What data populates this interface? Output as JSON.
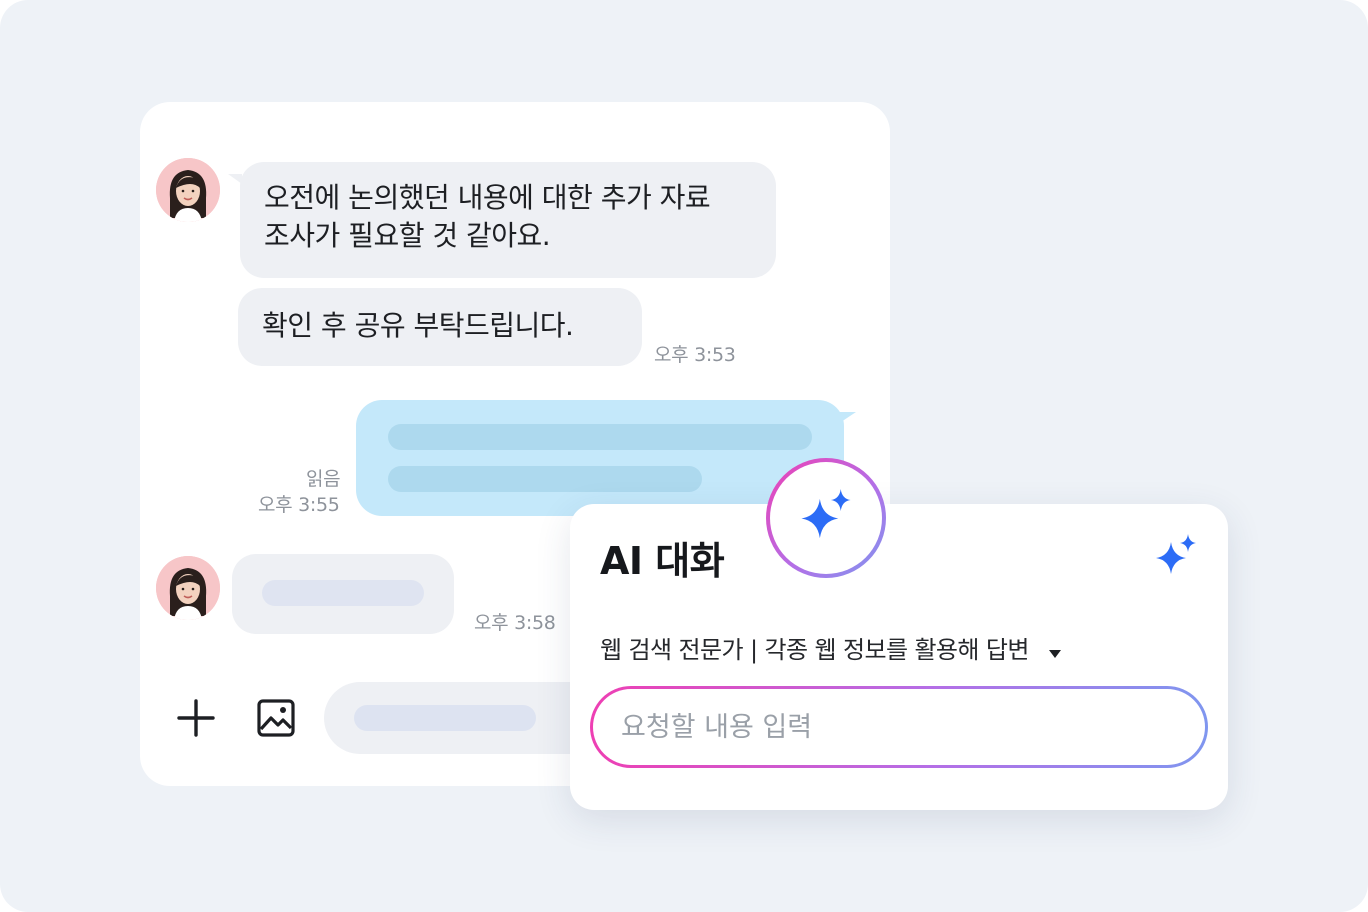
{
  "chat": {
    "messages": [
      {
        "line1": "오전에 논의했던 내용에 대한 추가 자료",
        "line2": "조사가 필요할 것 같아요."
      },
      {
        "text": "확인 후 공유 부탁드립니다.",
        "time": "오후 3:53"
      }
    ],
    "sent": {
      "status": "읽음",
      "time": "오후 3:55"
    },
    "reply": {
      "time": "오후 3:58"
    }
  },
  "icons": {
    "add": "plus-icon",
    "image": "image-icon",
    "sparkle": "sparkle-icon",
    "dropdown": "caret-down-icon"
  },
  "ai": {
    "title": "AI 대화",
    "mode": "웹 검색 전문가 | 각종 웹 정보를 활용해 답변",
    "placeholder": "요청할 내용 입력"
  },
  "colors": {
    "background": "#eef2f7",
    "bubble": "#eef0f4",
    "sent_bubble": "#c4e8fa",
    "sparkle": "#2c6cf6",
    "gradient_start": "#ee3fb3",
    "gradient_end": "#7f96ef"
  }
}
